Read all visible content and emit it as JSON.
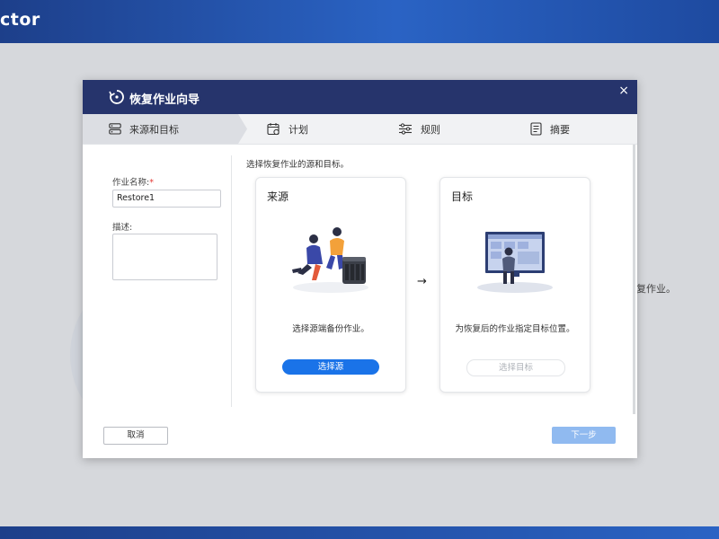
{
  "app": {
    "title": "ctor"
  },
  "background": {
    "text": "复作业。"
  },
  "dialog": {
    "title": "恢复作业向导",
    "close": "×",
    "steps": [
      {
        "label": "来源和目标",
        "icon": "server-icon",
        "active": true
      },
      {
        "label": "计划",
        "icon": "calendar-icon",
        "active": false
      },
      {
        "label": "规则",
        "icon": "sliders-icon",
        "active": false
      },
      {
        "label": "摘要",
        "icon": "document-icon",
        "active": false
      }
    ],
    "form": {
      "job_name_label": "作业名称:",
      "required_mark": "*",
      "job_name_value": "Restore1",
      "description_label": "描述:"
    },
    "instruction": "选择恢复作业的源和目标。",
    "source_card": {
      "title": "来源",
      "text": "选择源端备份作业。",
      "button": "选择源"
    },
    "arrow": "→",
    "target_card": {
      "title": "目标",
      "text": "为恢复后的作业指定目标位置。",
      "button": "选择目标"
    },
    "footer": {
      "cancel": "取消",
      "next": "下一步"
    }
  },
  "colors": {
    "header_bg": "#26346c",
    "primary": "#1a73e8",
    "next_disabled": "#90baf0",
    "app_header": "#2a63c4"
  }
}
